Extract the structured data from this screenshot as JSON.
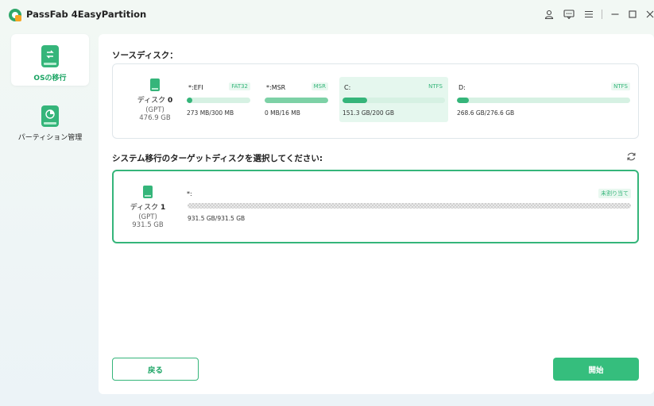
{
  "window": {
    "title": "PassFab 4EasyPartition",
    "icons": [
      "user-icon",
      "feedback-icon",
      "menu-icon",
      "minimize-icon",
      "maximize-icon",
      "close-icon"
    ]
  },
  "sidebar": {
    "items": [
      {
        "label": "OSの移行",
        "icon": "os-migrate-icon",
        "active": true
      },
      {
        "label": "パーティション管理",
        "icon": "partition-manage-icon",
        "active": false
      }
    ]
  },
  "source": {
    "title": "ソースディスク：",
    "disk": {
      "name": "ディスク",
      "number": "0",
      "type": "(GPT)",
      "size": "476.9 GB"
    },
    "partitions": [
      {
        "name": "*:EFI",
        "fs": "FAT32",
        "used": "273 MB/300 MB",
        "fill": 0.09,
        "selected": false
      },
      {
        "name": "*:MSR",
        "fs": "MSR",
        "used": "0 MB/16 MB",
        "fill": 1.0,
        "selected": false
      },
      {
        "name": "C:",
        "fs": "NTFS",
        "used": "151.3 GB/200 GB",
        "fill": 0.24,
        "selected": true
      },
      {
        "name": "D:",
        "fs": "NTFS",
        "used": "268.6 GB/276.6 GB",
        "fill": 0.03,
        "selected": false
      }
    ]
  },
  "target": {
    "title": "システム移行のターゲットディスクを選択してください:",
    "disk": {
      "name": "ディスク",
      "number": "1",
      "type": "(GPT)",
      "size": "931.5 GB"
    },
    "partition": {
      "name": "*:",
      "tag": "未割り当て",
      "used": "931.5 GB/931.5 GB"
    }
  },
  "buttons": {
    "back": "戻る",
    "start": "開始"
  },
  "colors": {
    "accent": "#35b57a",
    "accent_light": "#d6f1e3",
    "selected_bg": "#e5f7ee"
  }
}
